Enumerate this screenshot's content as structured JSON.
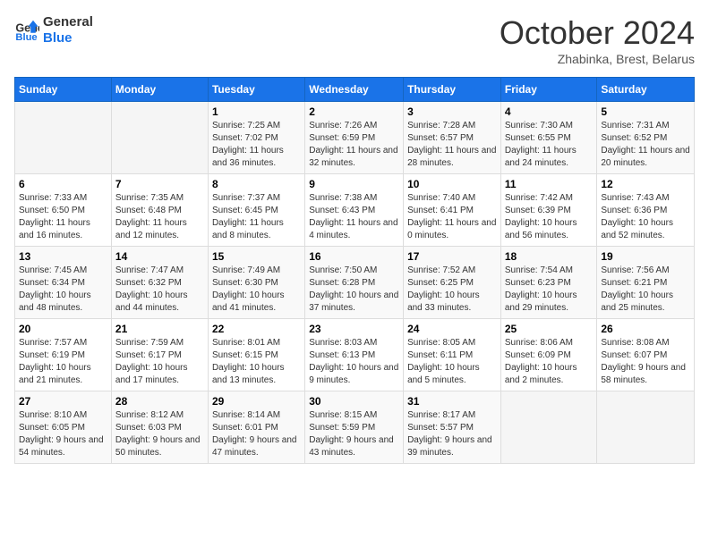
{
  "logo": {
    "line1": "General",
    "line2": "Blue"
  },
  "title": "October 2024",
  "subtitle": "Zhabinka, Brest, Belarus",
  "days_header": [
    "Sunday",
    "Monday",
    "Tuesday",
    "Wednesday",
    "Thursday",
    "Friday",
    "Saturday"
  ],
  "weeks": [
    [
      {
        "day": "",
        "sunrise": "",
        "sunset": "",
        "daylight": ""
      },
      {
        "day": "",
        "sunrise": "",
        "sunset": "",
        "daylight": ""
      },
      {
        "day": "1",
        "sunrise": "Sunrise: 7:25 AM",
        "sunset": "Sunset: 7:02 PM",
        "daylight": "Daylight: 11 hours and 36 minutes."
      },
      {
        "day": "2",
        "sunrise": "Sunrise: 7:26 AM",
        "sunset": "Sunset: 6:59 PM",
        "daylight": "Daylight: 11 hours and 32 minutes."
      },
      {
        "day": "3",
        "sunrise": "Sunrise: 7:28 AM",
        "sunset": "Sunset: 6:57 PM",
        "daylight": "Daylight: 11 hours and 28 minutes."
      },
      {
        "day": "4",
        "sunrise": "Sunrise: 7:30 AM",
        "sunset": "Sunset: 6:55 PM",
        "daylight": "Daylight: 11 hours and 24 minutes."
      },
      {
        "day": "5",
        "sunrise": "Sunrise: 7:31 AM",
        "sunset": "Sunset: 6:52 PM",
        "daylight": "Daylight: 11 hours and 20 minutes."
      }
    ],
    [
      {
        "day": "6",
        "sunrise": "Sunrise: 7:33 AM",
        "sunset": "Sunset: 6:50 PM",
        "daylight": "Daylight: 11 hours and 16 minutes."
      },
      {
        "day": "7",
        "sunrise": "Sunrise: 7:35 AM",
        "sunset": "Sunset: 6:48 PM",
        "daylight": "Daylight: 11 hours and 12 minutes."
      },
      {
        "day": "8",
        "sunrise": "Sunrise: 7:37 AM",
        "sunset": "Sunset: 6:45 PM",
        "daylight": "Daylight: 11 hours and 8 minutes."
      },
      {
        "day": "9",
        "sunrise": "Sunrise: 7:38 AM",
        "sunset": "Sunset: 6:43 PM",
        "daylight": "Daylight: 11 hours and 4 minutes."
      },
      {
        "day": "10",
        "sunrise": "Sunrise: 7:40 AM",
        "sunset": "Sunset: 6:41 PM",
        "daylight": "Daylight: 11 hours and 0 minutes."
      },
      {
        "day": "11",
        "sunrise": "Sunrise: 7:42 AM",
        "sunset": "Sunset: 6:39 PM",
        "daylight": "Daylight: 10 hours and 56 minutes."
      },
      {
        "day": "12",
        "sunrise": "Sunrise: 7:43 AM",
        "sunset": "Sunset: 6:36 PM",
        "daylight": "Daylight: 10 hours and 52 minutes."
      }
    ],
    [
      {
        "day": "13",
        "sunrise": "Sunrise: 7:45 AM",
        "sunset": "Sunset: 6:34 PM",
        "daylight": "Daylight: 10 hours and 48 minutes."
      },
      {
        "day": "14",
        "sunrise": "Sunrise: 7:47 AM",
        "sunset": "Sunset: 6:32 PM",
        "daylight": "Daylight: 10 hours and 44 minutes."
      },
      {
        "day": "15",
        "sunrise": "Sunrise: 7:49 AM",
        "sunset": "Sunset: 6:30 PM",
        "daylight": "Daylight: 10 hours and 41 minutes."
      },
      {
        "day": "16",
        "sunrise": "Sunrise: 7:50 AM",
        "sunset": "Sunset: 6:28 PM",
        "daylight": "Daylight: 10 hours and 37 minutes."
      },
      {
        "day": "17",
        "sunrise": "Sunrise: 7:52 AM",
        "sunset": "Sunset: 6:25 PM",
        "daylight": "Daylight: 10 hours and 33 minutes."
      },
      {
        "day": "18",
        "sunrise": "Sunrise: 7:54 AM",
        "sunset": "Sunset: 6:23 PM",
        "daylight": "Daylight: 10 hours and 29 minutes."
      },
      {
        "day": "19",
        "sunrise": "Sunrise: 7:56 AM",
        "sunset": "Sunset: 6:21 PM",
        "daylight": "Daylight: 10 hours and 25 minutes."
      }
    ],
    [
      {
        "day": "20",
        "sunrise": "Sunrise: 7:57 AM",
        "sunset": "Sunset: 6:19 PM",
        "daylight": "Daylight: 10 hours and 21 minutes."
      },
      {
        "day": "21",
        "sunrise": "Sunrise: 7:59 AM",
        "sunset": "Sunset: 6:17 PM",
        "daylight": "Daylight: 10 hours and 17 minutes."
      },
      {
        "day": "22",
        "sunrise": "Sunrise: 8:01 AM",
        "sunset": "Sunset: 6:15 PM",
        "daylight": "Daylight: 10 hours and 13 minutes."
      },
      {
        "day": "23",
        "sunrise": "Sunrise: 8:03 AM",
        "sunset": "Sunset: 6:13 PM",
        "daylight": "Daylight: 10 hours and 9 minutes."
      },
      {
        "day": "24",
        "sunrise": "Sunrise: 8:05 AM",
        "sunset": "Sunset: 6:11 PM",
        "daylight": "Daylight: 10 hours and 5 minutes."
      },
      {
        "day": "25",
        "sunrise": "Sunrise: 8:06 AM",
        "sunset": "Sunset: 6:09 PM",
        "daylight": "Daylight: 10 hours and 2 minutes."
      },
      {
        "day": "26",
        "sunrise": "Sunrise: 8:08 AM",
        "sunset": "Sunset: 6:07 PM",
        "daylight": "Daylight: 9 hours and 58 minutes."
      }
    ],
    [
      {
        "day": "27",
        "sunrise": "Sunrise: 8:10 AM",
        "sunset": "Sunset: 6:05 PM",
        "daylight": "Daylight: 9 hours and 54 minutes."
      },
      {
        "day": "28",
        "sunrise": "Sunrise: 8:12 AM",
        "sunset": "Sunset: 6:03 PM",
        "daylight": "Daylight: 9 hours and 50 minutes."
      },
      {
        "day": "29",
        "sunrise": "Sunrise: 8:14 AM",
        "sunset": "Sunset: 6:01 PM",
        "daylight": "Daylight: 9 hours and 47 minutes."
      },
      {
        "day": "30",
        "sunrise": "Sunrise: 8:15 AM",
        "sunset": "Sunset: 5:59 PM",
        "daylight": "Daylight: 9 hours and 43 minutes."
      },
      {
        "day": "31",
        "sunrise": "Sunrise: 8:17 AM",
        "sunset": "Sunset: 5:57 PM",
        "daylight": "Daylight: 9 hours and 39 minutes."
      },
      {
        "day": "",
        "sunrise": "",
        "sunset": "",
        "daylight": ""
      },
      {
        "day": "",
        "sunrise": "",
        "sunset": "",
        "daylight": ""
      }
    ]
  ]
}
